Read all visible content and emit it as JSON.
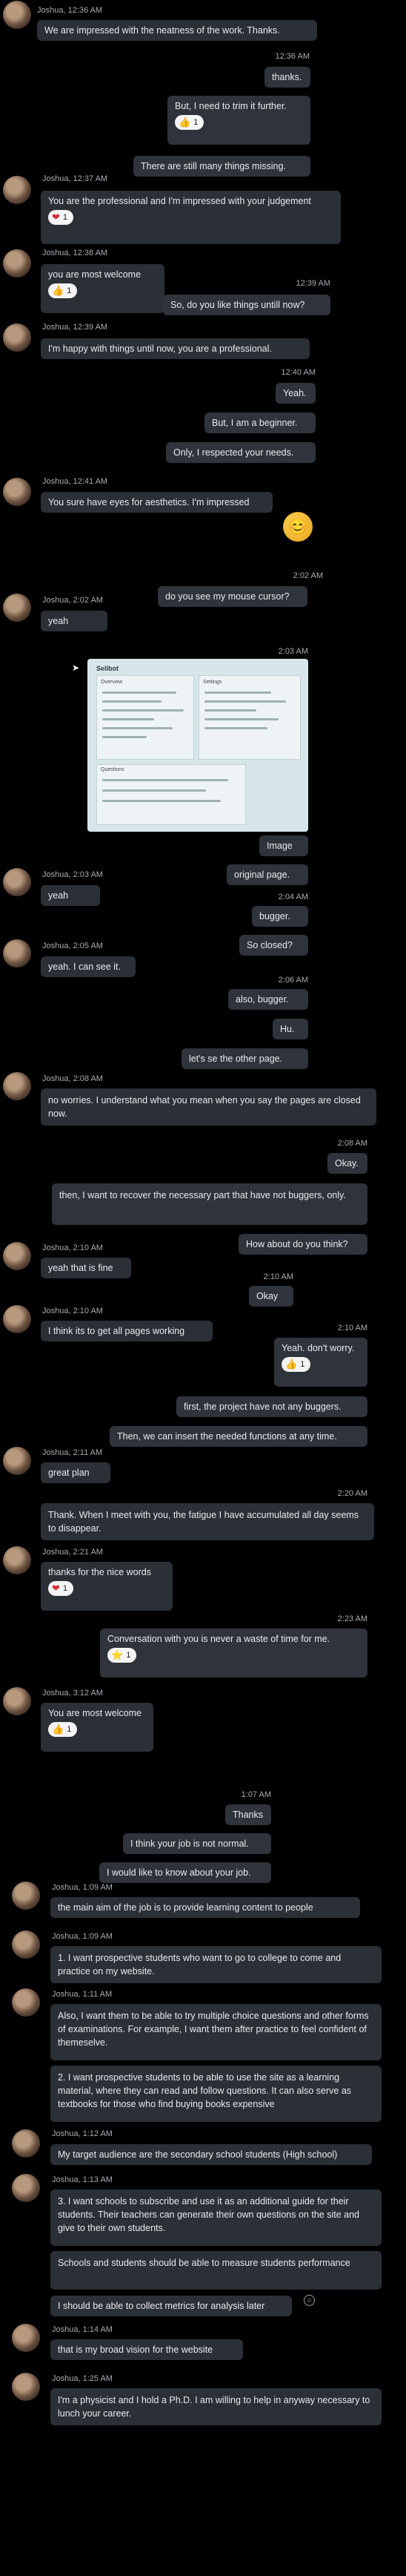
{
  "messages": [
    {
      "sender": "Joshua",
      "time": "12:36 AM",
      "text": "We are impressed with the neatness of the work. Thanks."
    },
    {
      "time": "12:36 AM",
      "text": "thanks."
    },
    {
      "text": "But, I need to trim it further.",
      "reaction": {
        "icon": "thumbs-up",
        "count": "1"
      }
    },
    {
      "text": "There are still many things missing."
    },
    {
      "sender": "Joshua",
      "time": "12:37 AM",
      "text": "You are the professional and I'm impressed with your judgement",
      "reaction": {
        "icon": "heart",
        "count": "1"
      }
    },
    {
      "sender": "Joshua",
      "time": "12:38 AM",
      "text": "you are most welcome",
      "reaction": {
        "icon": "thumbs-up",
        "count": "1"
      }
    },
    {
      "time": "12:39 AM",
      "text": "So, do you like things untill now?"
    },
    {
      "sender": "Joshua",
      "time": "12:39 AM",
      "text": "I'm happy with things until now, you are a professional."
    },
    {
      "time": "12:40 AM",
      "text": "Yeah."
    },
    {
      "text": "But, I am a beginner."
    },
    {
      "text": "Only, I respected your needs."
    },
    {
      "sender": "Joshua",
      "time": "12:41 AM",
      "text": "You sure have eyes for aesthetics. I'm impressed"
    },
    {
      "time": "2:02 AM",
      "text": "do you see my mouse cursor?"
    },
    {
      "sender": "Joshua",
      "time": "2:02 AM",
      "text": "yeah"
    },
    {
      "time": "2:03 AM",
      "text": "Image"
    },
    {
      "text": "original page."
    },
    {
      "sender": "Joshua",
      "time": "2:03 AM",
      "text": "yeah"
    },
    {
      "time": "2:04 AM",
      "text": "bugger."
    },
    {
      "text": "So closed?"
    },
    {
      "sender": "Joshua",
      "time": "2:05 AM",
      "text": "yeah. I can see it."
    },
    {
      "time": "2:06 AM",
      "text": "also, bugger."
    },
    {
      "text": "Hu."
    },
    {
      "text": "let's se  the other page."
    },
    {
      "sender": "Joshua",
      "time": "2:08 AM",
      "text": "no worries. I understand what you mean when you say the pages are closed now."
    },
    {
      "time": "2:08 AM",
      "text": "Okay."
    },
    {
      "text": "then, I want to recover the necessary part that have not buggers, only."
    },
    {
      "text": "How about do you think?"
    },
    {
      "sender": "Joshua",
      "time": "2:10 AM",
      "text": "yeah that is fine"
    },
    {
      "time": "2:10 AM",
      "text": "Okay"
    },
    {
      "sender": "Joshua",
      "time": "2:10 AM",
      "text": "I think its to get all pages working"
    },
    {
      "time": "2:10 AM",
      "text": "Yeah. don't worry.",
      "reaction": {
        "icon": "thumbs-up",
        "count": "1"
      }
    },
    {
      "text": "first, the project have not any buggers."
    },
    {
      "text": "Then, we can insert the needed functions at any time."
    },
    {
      "sender": "Joshua",
      "time": "2:11 AM",
      "text": "great plan"
    },
    {
      "time": "2:20 AM",
      "text": "Thank. When I  meet with you, the fatigue I have accumulated all day seems to disappear."
    },
    {
      "sender": "Joshua",
      "time": "2:21 AM",
      "text": "thanks for the nice words",
      "reaction": {
        "icon": "heart",
        "count": "1"
      }
    },
    {
      "time": "2:23 AM",
      "text": "Conversation with you is never a waste of time for me.",
      "reaction": {
        "icon": "star",
        "count": "1"
      }
    },
    {
      "sender": "Joshua",
      "time": "3:12 AM",
      "text": "You are most welcome",
      "reaction": {
        "icon": "thumbs-up",
        "count": "1"
      }
    },
    {
      "time": "1:07 AM",
      "text": "Thanks"
    },
    {
      "text": "I think your job is not normal."
    },
    {
      "text": "I would like to know about your job."
    },
    {
      "sender": "Joshua",
      "time": "1:09 AM",
      "text": "the main aim of the job is to provide learning content to people"
    },
    {
      "sender": "Joshua",
      "time": "1:09 AM",
      "text": "1. I want prospective students who want to go to college to come and practice on my website."
    },
    {
      "sender": "Joshua",
      "time": "1:11 AM",
      "text": "Also, I want them to be able to try multiple choice questions and other forms of examinations. For example, I want them after practice to feel confident of themeselve."
    },
    {
      "text": "2. I want prospective students to be able to use the site as a learning material, where they can read and follow questions. It can also serve as textbooks for those who find buying books expensive"
    },
    {
      "sender": "Joshua",
      "time": "1:12 AM",
      "text": "My target audience are the secondary school students (High school)"
    },
    {
      "sender": "Joshua",
      "time": "1:13 AM",
      "text": "3. I want schools to subscribe and use it as an additional guide for their students. Their teachers can generate their own questions on the site and give to their own students."
    },
    {
      "text": "Schools and students should be able to measure students performance"
    },
    {
      "text": "I should be able to collect metrics for analysis later"
    },
    {
      "sender": "Joshua",
      "time": "1:14 AM",
      "text": "that is my broad vision for the website"
    },
    {
      "sender": "Joshua",
      "time": "1:25 AM",
      "text": "I'm a physicist and I hold a Ph.D. I am willing to help in anyway necessary to lunch your career."
    }
  ],
  "screenshot_preview": {
    "title": "Sellbot",
    "left_heading": "Overview",
    "right_heading": "Settings",
    "bottom_heading": "Questions"
  }
}
